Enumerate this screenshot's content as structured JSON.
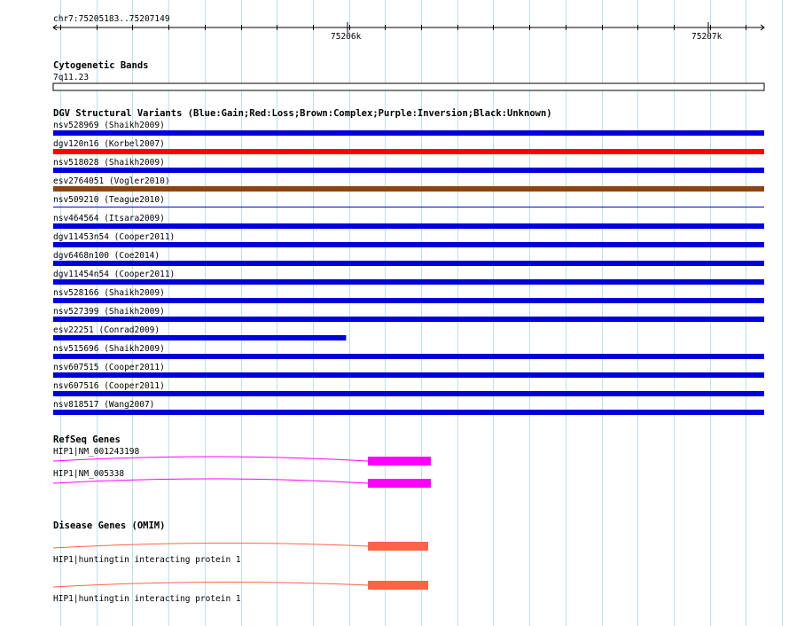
{
  "ruler": {
    "region": "chr7:75205183..75207149",
    "ticks": [
      "75206k",
      "75207k"
    ]
  },
  "tracks": {
    "cytoband": {
      "title": "Cytogenetic Bands",
      "band": "7q11.23"
    },
    "dgv": {
      "title": "DGV Structural Variants (Blue:Gain;Red:Loss;Brown:Complex;Purple:Inversion;Black:Unknown)",
      "colors": {
        "gain": "#0000dd",
        "loss": "#ff0000",
        "complex": "#8b4513"
      },
      "items": [
        {
          "label": "nsv528969 (Shaikh2009)",
          "type": "gain",
          "end": 1.0
        },
        {
          "label": "dgv120n16 (Korbel2007)",
          "type": "loss",
          "end": 1.0
        },
        {
          "label": "nsv518028 (Shaikh2009)",
          "type": "gain",
          "end": 1.0
        },
        {
          "label": "esv2764051 (Vogler2010)",
          "type": "complex",
          "end": 1.0
        },
        {
          "label": "nsv509210 (Teague2010)",
          "type": "gain",
          "end": 1.0,
          "thin": true
        },
        {
          "label": "nsv464564 (Itsara2009)",
          "type": "gain",
          "end": 1.0
        },
        {
          "label": "dgv11453n54 (Cooper2011)",
          "type": "gain",
          "end": 1.0
        },
        {
          "label": "dgv6468n100 (Coe2014)",
          "type": "gain",
          "end": 1.0
        },
        {
          "label": "dgv11454n54 (Cooper2011)",
          "type": "gain",
          "end": 1.0
        },
        {
          "label": "nsv528166 (Shaikh2009)",
          "type": "gain",
          "end": 1.0
        },
        {
          "label": "nsv527399 (Shaikh2009)",
          "type": "gain",
          "end": 1.0
        },
        {
          "label": "esv22251 (Conrad2009)",
          "type": "gain",
          "end": 0.412
        },
        {
          "label": "nsv515696 (Shaikh2009)",
          "type": "gain",
          "end": 1.0
        },
        {
          "label": "nsv607515 (Cooper2011)",
          "type": "gain",
          "end": 1.0
        },
        {
          "label": "nsv607516 (Cooper2011)",
          "type": "gain",
          "end": 1.0
        },
        {
          "label": "nsv818517 (Wang2007)",
          "type": "gain",
          "end": 1.0
        }
      ]
    },
    "refseq": {
      "title": "RefSeq Genes",
      "color": "#ff00ff",
      "genes": [
        {
          "label": "HIP1|NM_001243198"
        },
        {
          "label": "HIP1|NM_005338"
        }
      ]
    },
    "omim": {
      "title": "Disease Genes (OMIM)",
      "color": "#ff6347",
      "genes": [
        {
          "label": "HIP1|huntingtin interacting protein 1"
        },
        {
          "label": "HIP1|huntingtin interacting protein 1"
        }
      ]
    }
  }
}
